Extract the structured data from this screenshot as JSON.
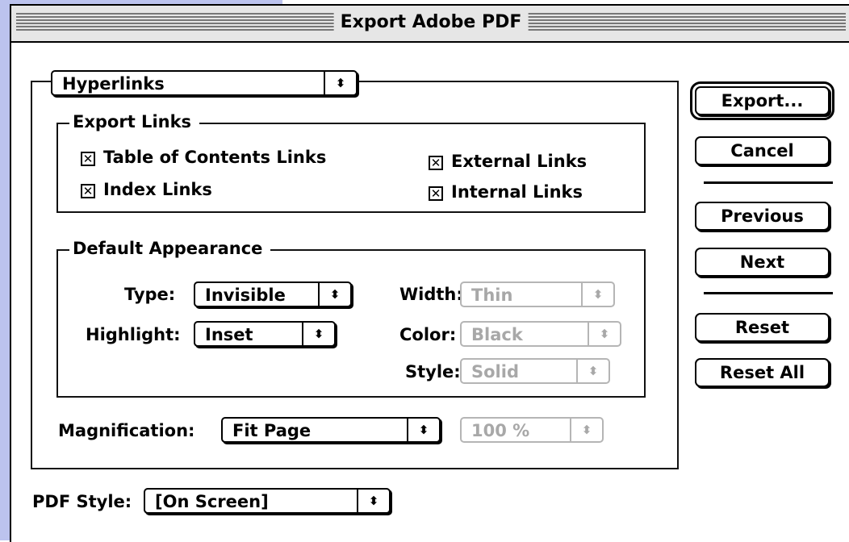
{
  "window": {
    "title": "Export Adobe PDF"
  },
  "section_popup": {
    "value": "Hyperlinks"
  },
  "export_links": {
    "legend": "Export Links",
    "table_of_contents": {
      "label": "Table of Contents Links",
      "checked": true
    },
    "index_links": {
      "label": "Index Links",
      "checked": true
    },
    "external_links": {
      "label": "External Links",
      "checked": true
    },
    "internal_links": {
      "label": "Internal Links",
      "checked": true
    },
    "check_mark": "✕"
  },
  "default_appearance": {
    "legend": "Default Appearance",
    "type": {
      "label": "Type:",
      "value": "Invisible"
    },
    "highlight": {
      "label": "Highlight:",
      "value": "Inset"
    },
    "width": {
      "label": "Width:",
      "value": "Thin",
      "enabled": false
    },
    "color": {
      "label": "Color:",
      "value": "Black",
      "enabled": false
    },
    "style": {
      "label": "Style:",
      "value": "Solid",
      "enabled": false
    }
  },
  "magnification": {
    "label": "Magnification:",
    "value": "Fit Page",
    "percent": "100 %",
    "percent_enabled": false
  },
  "pdf_style": {
    "label": "PDF Style:",
    "value": "[On Screen]"
  },
  "buttons": {
    "export": "Export...",
    "cancel": "Cancel",
    "previous": "Previous",
    "next": "Next",
    "reset": "Reset",
    "reset_all": "Reset All"
  },
  "icons": {
    "popup_arrows": "⬍"
  }
}
